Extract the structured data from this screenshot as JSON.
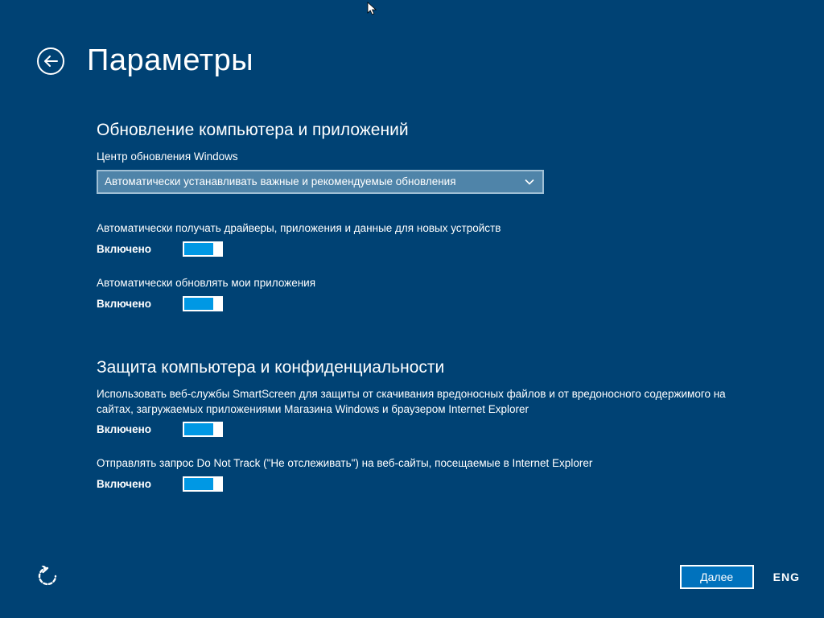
{
  "page_title": "Параметры",
  "sections": {
    "update": {
      "heading": "Обновление компьютера и приложений",
      "wu_label": "Центр обновления Windows",
      "wu_dropdown_value": "Автоматически устанавливать важные и рекомендуемые обновления",
      "opt1_label": "Автоматически получать драйверы, приложения и данные для новых устройств",
      "opt1_status": "Включено",
      "opt2_label": "Автоматически обновлять мои приложения",
      "opt2_status": "Включено"
    },
    "privacy": {
      "heading": "Защита компьютера и конфиденциальности",
      "opt1_label": "Использовать веб-службы SmartScreen для защиты от скачивания вредоносных файлов и от вредоносного содержимого на сайтах, загружаемых приложениями Магазина Windows и браузером Internet Explorer",
      "opt1_status": "Включено",
      "opt2_label": "Отправлять запрос Do Not Track (\"Не отслеживать\") на веб-сайты, посещаемые в Internet Explorer",
      "opt2_status": "Включено"
    }
  },
  "footer": {
    "next": "Далее",
    "language": "ENG"
  }
}
